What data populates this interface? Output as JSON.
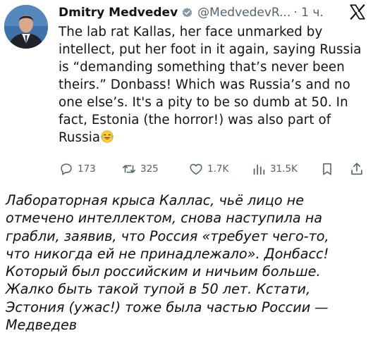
{
  "tweet": {
    "author_name": "Dmitry Medvedev",
    "handle": "@MedvedevR...",
    "time": "· 1 ч.",
    "text_lines": [
      "The lab rat Kallas, her face unmarked by",
      "intellect, put her foot in it again, saying Russia",
      "is “demanding something that’s never been",
      "theirs.” Donbass! Which was Russia’s and no",
      "one else’s. It's a pity to be so dumb at 50. In",
      "fact, Estonia (the horror!) was also part of",
      "Russia"
    ],
    "emoji": "laughing-tears-emoji",
    "verified_icon": "verified-badge-icon",
    "actions": {
      "replies": "173",
      "reposts": "325",
      "likes": "1.7K",
      "views": "31.5K"
    }
  },
  "translation": {
    "lines": [
      "Лабораторная крыса Каллас, чьё лицо не",
      "отмечено интеллектом, снова наступила на",
      "грабли, заявив, что Россия «требует чего-то,",
      "что никогда ей не принадлежало». Донбасс!",
      "Который был российским и ничьим больше.",
      "Жалко быть такой тупой в 50 лет. Кстати,",
      "Эстония (ужас!) тоже была частью России —",
      "Медведев"
    ]
  },
  "colors": {
    "text": "#0f1419",
    "secondary": "#536471",
    "verified_badge": "#829aab",
    "avatar_bg": "#3d6fa8"
  }
}
